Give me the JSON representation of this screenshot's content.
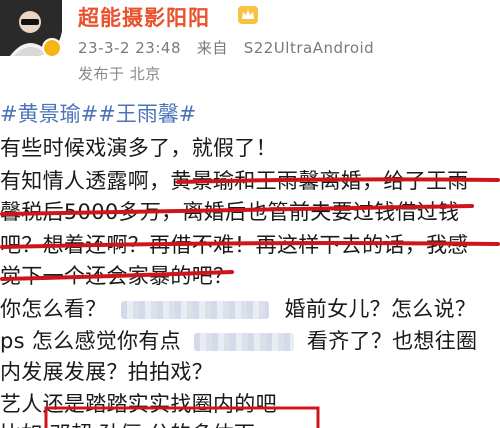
{
  "post": {
    "username": "超能摄影阳阳",
    "time": "23-3-2 23:48",
    "source_prefix": "来自",
    "source": "S22UltraAndroid",
    "location": "发布于 北京",
    "hashtags": "#黄景瑜##王雨馨#",
    "lines": [
      "有些时候戏演多了，就假了！",
      "有知情人透露啊，黄景瑜和王雨馨离婚，给了王雨",
      "馨税后5000多万，离婚后也管前夫要过钱借过钱",
      "吧？想着还啊？再借不难！再这样下去的话，我感",
      "觉下一个还会家暴的吧？",
      "你怎么看？",
      "婚前女儿？怎么说？",
      "ps 怎么感觉你有点",
      "看齐了？也想往圈",
      "内发展发展？拍拍戏？",
      "艺人还是踏踏实实找圈内的吧",
      "比如 邓超 孙俪 分的多体面"
    ]
  },
  "colors": {
    "username": "#e9522c",
    "hashtag": "#4b74b8",
    "annotation": "#d0141c",
    "meta": "#7a7a7a"
  },
  "icons": {
    "avatar": "avatar-image",
    "vip_badge": "vip-badge-icon",
    "crown": "crown-icon"
  }
}
